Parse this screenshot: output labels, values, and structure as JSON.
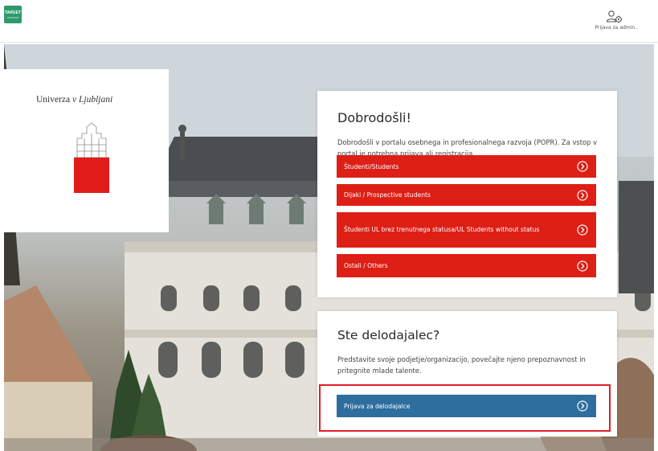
{
  "header": {
    "logo_text": "TARGET",
    "logo_sub": "connect",
    "admin_label": "Prijava za admin.."
  },
  "university": {
    "name_part1": "Univerza",
    "name_part2": "v Ljubljani"
  },
  "welcome": {
    "title": "Dobrodošli!",
    "text": "Dobrodošli v portalu osebnega in profesionalnega razvoja (POPR). Za vstop v portal je potrebna prijava ali registracija.",
    "buttons": [
      {
        "label": "Študenti/Students"
      },
      {
        "label": "Dijaki / Prospective students"
      },
      {
        "label": "Študenti UL brez trenutnega statusa/UL Students without status"
      },
      {
        "label": "Ostali / Others"
      }
    ]
  },
  "employer": {
    "title": "Ste delodajalec?",
    "text": "Predstavite svoje podjetje/organizacijo, povečajte njeno prepoznavnost in pritegnite mlade talente.",
    "button_label": "Prijava za delodajalce"
  },
  "colors": {
    "primary_red": "#dd1f15",
    "employer_blue": "#2d6e9e",
    "highlight_red": "#e01f26",
    "logo_green": "#2e9a6b"
  },
  "icons": {
    "admin": "users-gear-icon",
    "button_arrow": "chevron-right-circle-icon"
  }
}
